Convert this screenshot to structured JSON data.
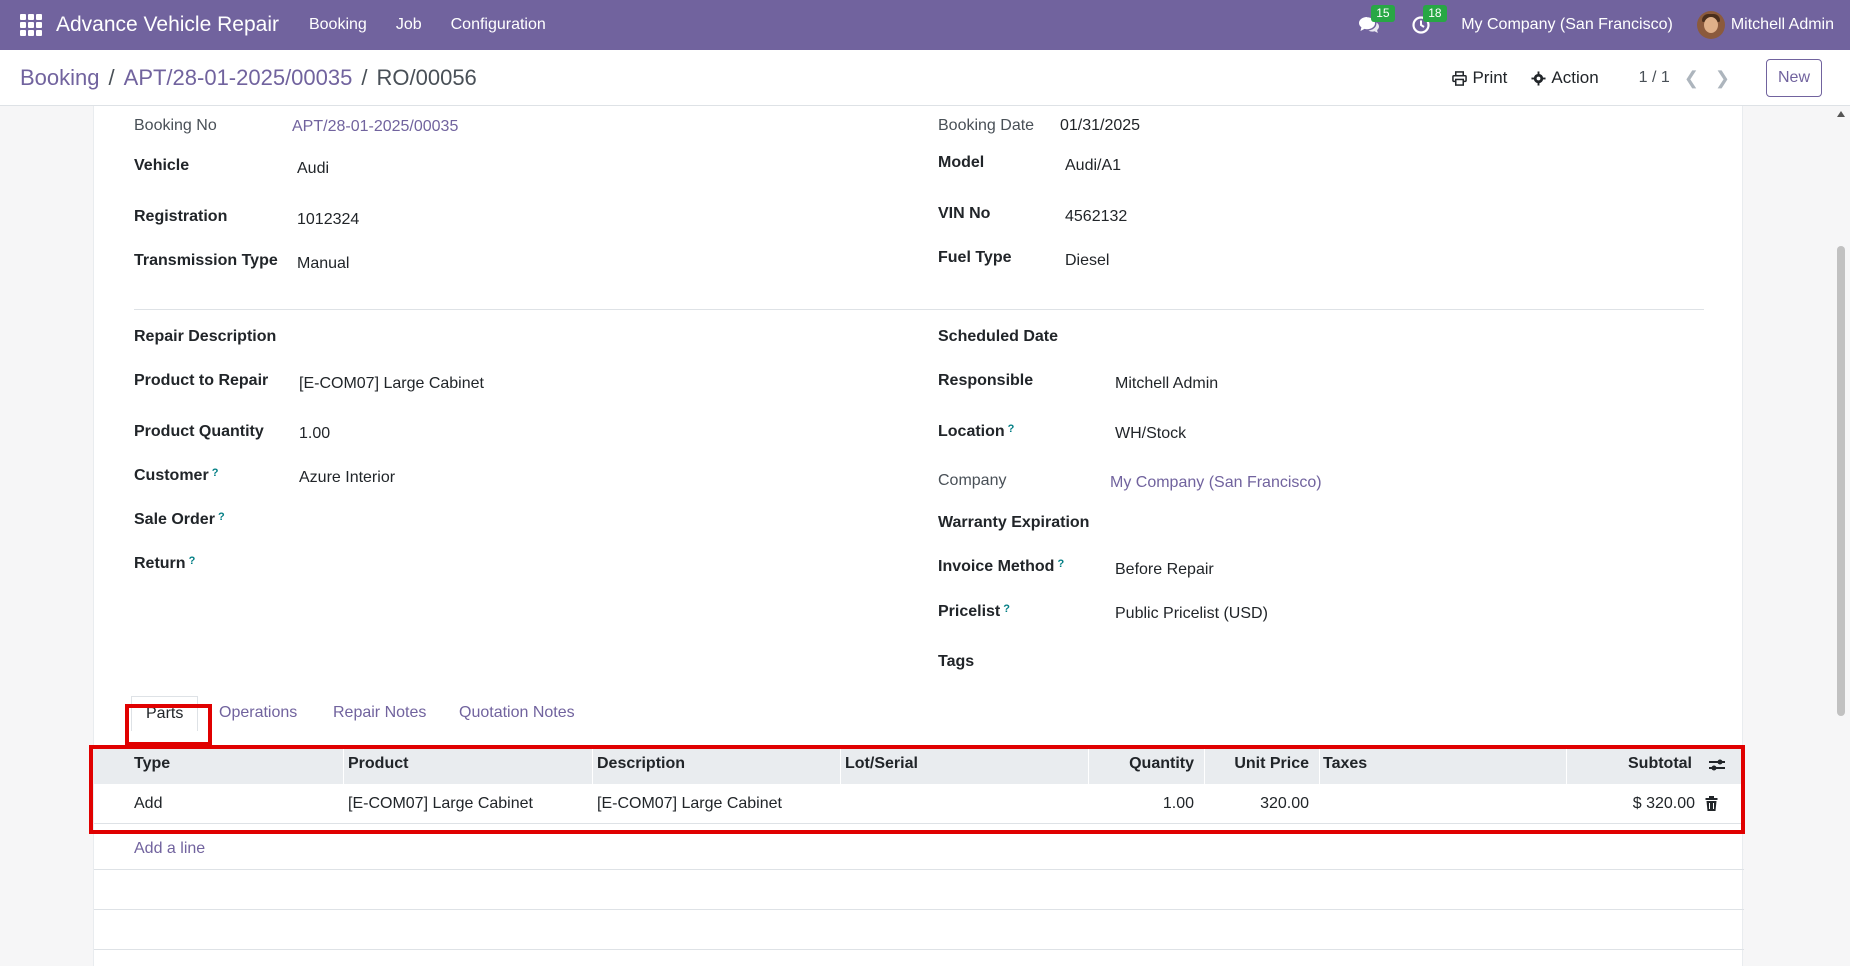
{
  "navbar": {
    "app_name": "Advance Vehicle Repair",
    "menus": [
      "Booking",
      "Job",
      "Configuration"
    ],
    "messages_count": "15",
    "activities_count": "18",
    "company": "My Company (San Francisco)",
    "user": "Mitchell Admin"
  },
  "breadcrumb": {
    "root": "Booking",
    "parent": "APT/28-01-2025/00035",
    "sep": "/",
    "current": "RO/00056"
  },
  "control": {
    "print_label": "Print",
    "action_label": "Action",
    "pager": "1 / 1",
    "new_label": "New"
  },
  "booking": {
    "booking_no_label": "Booking No",
    "booking_no": "APT/28-01-2025/00035",
    "booking_date_label": "Booking Date",
    "booking_date": "01/31/2025",
    "vehicle_label": "Vehicle",
    "vehicle": "Audi",
    "model_label": "Model",
    "model": "Audi/A1",
    "registration_label": "Registration",
    "registration": "1012324",
    "vin_label": "VIN No",
    "vin": "4562132",
    "transmission_label": "Transmission Type",
    "transmission": "Manual",
    "fuel_label": "Fuel Type",
    "fuel": "Diesel"
  },
  "repair": {
    "description_label": "Repair Description",
    "product_label": "Product to Repair",
    "product": "[E-COM07] Large Cabinet",
    "quantity_label": "Product Quantity",
    "quantity": "1.00",
    "customer_label": "Customer",
    "customer": "Azure Interior",
    "sale_order_label": "Sale Order",
    "return_label": "Return",
    "scheduled_label": "Scheduled Date",
    "responsible_label": "Responsible",
    "responsible": "Mitchell Admin",
    "location_label": "Location",
    "location": "WH/Stock",
    "company_label": "Company",
    "company": "My Company (San Francisco)",
    "warranty_label": "Warranty Expiration",
    "invoice_label": "Invoice Method",
    "invoice": "Before Repair",
    "pricelist_label": "Pricelist",
    "pricelist": "Public Pricelist (USD)",
    "tags_label": "Tags",
    "help_mark": "?"
  },
  "tabs": [
    "Parts",
    "Operations",
    "Repair Notes",
    "Quotation Notes"
  ],
  "parts_table": {
    "columns": [
      "Type",
      "Product",
      "Description",
      "Lot/Serial",
      "Quantity",
      "Unit Price",
      "Taxes",
      "Subtotal"
    ],
    "rows": [
      {
        "type": "Add",
        "product": "[E-COM07] Large Cabinet",
        "description": "[E-COM07] Large Cabinet",
        "lot": "",
        "quantity": "1.00",
        "unit_price": "320.00",
        "taxes": "",
        "subtotal": "$ 320.00"
      }
    ],
    "add_line": "Add a line"
  },
  "colors": {
    "navbar": "#71639e",
    "highlight": "#e00000",
    "link": "#71639e"
  }
}
